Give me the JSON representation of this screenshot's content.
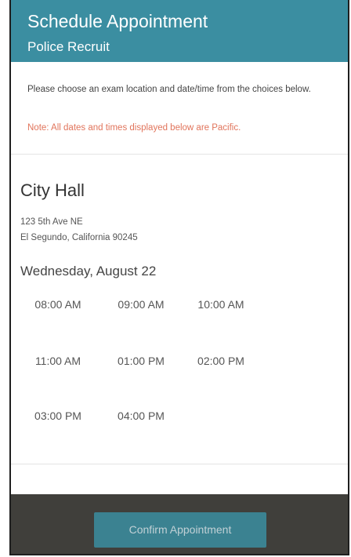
{
  "header": {
    "title": "Schedule Appointment",
    "subtitle": "Police Recruit"
  },
  "instructions": {
    "text": "Please choose an exam location and date/time from the choices below.",
    "note": "Note: All dates and times displayed below are Pacific."
  },
  "location": {
    "name": "City Hall",
    "address_line1": "123 5th Ave NE",
    "address_line2": "El Segundo, California 90245",
    "date": "Wednesday, August 22",
    "times": [
      "08:00 AM",
      "09:00 AM",
      "10:00 AM",
      "11:00 AM",
      "01:00 PM",
      "02:00 PM",
      "03:00 PM",
      "04:00 PM"
    ]
  },
  "footer": {
    "confirm_label": "Confirm Appointment"
  },
  "colors": {
    "accent": "#3b8ea1",
    "note": "#e1745b",
    "footer_bg": "#403f3b"
  }
}
